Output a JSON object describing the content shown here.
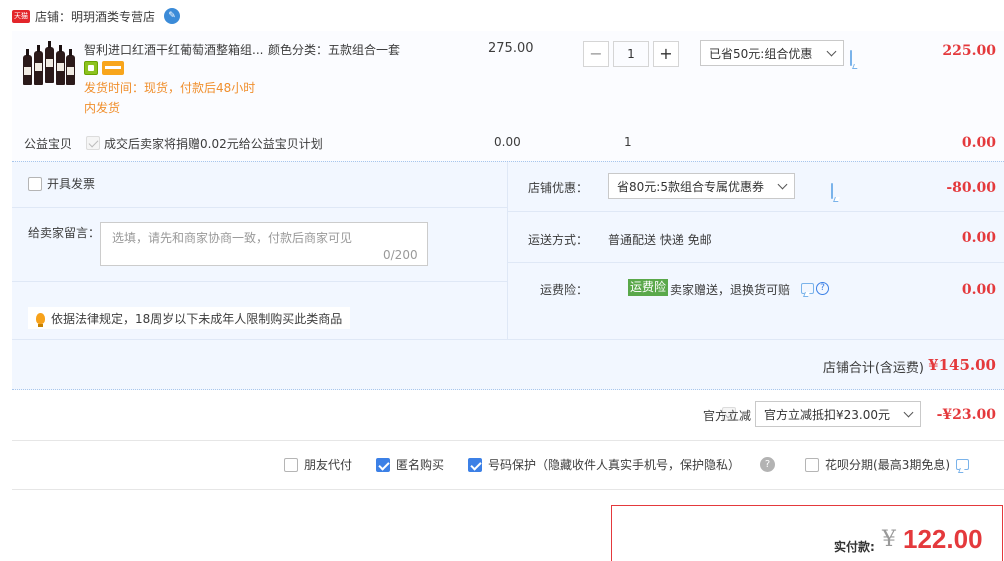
{
  "shop": {
    "label": "店铺：明玥酒类专营店",
    "badge": "天猫"
  },
  "item": {
    "title": "智利进口红酒干红葡萄酒整箱组...",
    "sku": "颜色分类：五款组合一套",
    "ship_time": "发货时间：现货，付款后48小时",
    "ship_note": "内发货",
    "unit_price": "275.00",
    "quantity": "1",
    "qty_minus": "−",
    "qty_plus": "+",
    "discount_selected": "已省50元:组合优惠",
    "total": "225.00"
  },
  "gift": {
    "label": "公益宝贝",
    "text": "成交后卖家将捐赠0.02元给公益宝贝计划",
    "price": "0.00",
    "qty": "1",
    "total": "0.00"
  },
  "invoice": {
    "label": "开具发票"
  },
  "memo": {
    "label": "给卖家留言：",
    "placeholder": "选填，请先和商家协商一致，付款后商家可见",
    "count": "0/200"
  },
  "law_notice": "依据法律规定，18周岁以下未成年人限制购买此类商品",
  "shop_coupon": {
    "label": "店铺优惠：",
    "selected": "省80元:5款组合专属优惠券",
    "value": "-80.00"
  },
  "delivery": {
    "label": "运送方式：",
    "value": "普通配送 快递 免邮",
    "total": "0.00"
  },
  "insurance": {
    "label": "运费险：",
    "badge": "运费险",
    "text": "卖家赠送，退换货可赔",
    "total": "0.00"
  },
  "shop_sum": {
    "label": "店铺合计(含运费)",
    "value": "¥145.00"
  },
  "official": {
    "label": "官方立减",
    "selected": "官方立减抵扣¥23.00元",
    "value": "-¥23.00"
  },
  "options": {
    "friend_pay": "朋友代付",
    "anonymous": "匿名购买",
    "number_protect": "号码保护（隐藏收件人真实手机号，保护隐私）",
    "installment": "花呗分期(最高3期免息)"
  },
  "payment": {
    "label": "实付款:",
    "currency": "¥",
    "amount": "122.00"
  },
  "colors": {
    "accent": "#e4393c",
    "blue": "#3c80e6",
    "panel": "#f2f7ff"
  }
}
